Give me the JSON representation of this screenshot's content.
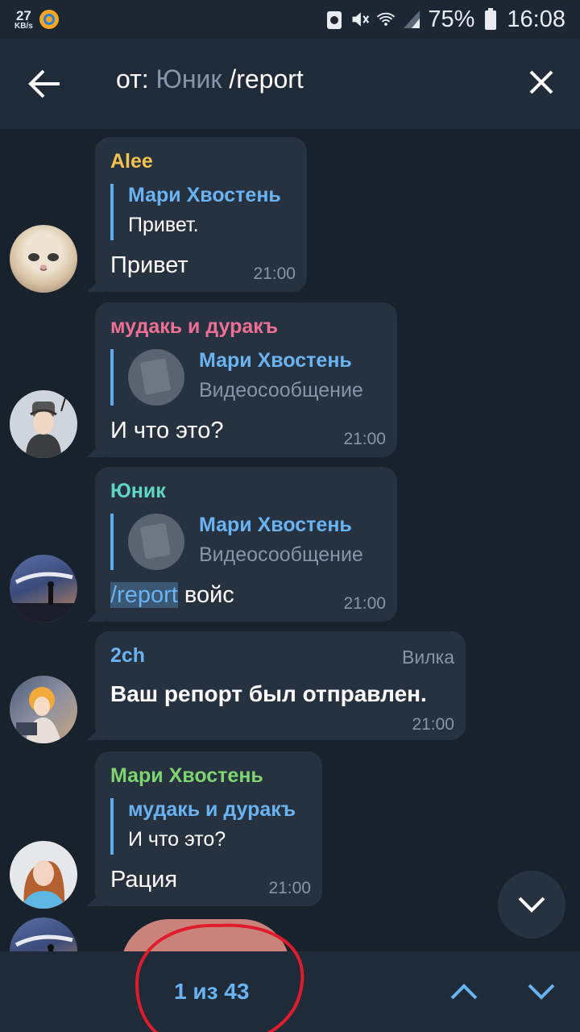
{
  "status_bar": {
    "net_speed": "27",
    "net_unit": "KB/s",
    "battery": "75%",
    "time": "16:08",
    "icons": [
      "app-icon",
      "recycle-icon",
      "mute-icon",
      "wifi-icon",
      "signal-icon",
      "battery-icon"
    ]
  },
  "header": {
    "search_prefix": "от: ",
    "search_user": "Юник",
    "search_query": " /report"
  },
  "messages": [
    {
      "sender": "Alee",
      "sender_color": "#f2c14e",
      "reply_name": "Мари Хвостень",
      "reply_text": "Привет.",
      "text": "Привет",
      "time": "21:00"
    },
    {
      "sender": "мудакь и дуракъ",
      "sender_color": "#ee6f93",
      "reply_name": "Мари Хвостень",
      "reply_text": "Видеосообщение",
      "text": "И что это?",
      "time": "21:00"
    },
    {
      "sender": "Юник",
      "sender_color": "#5fd6c4",
      "reply_name": "Мари Хвостень",
      "reply_text": "Видеосообщение",
      "text_highlight": "/report",
      "text_rest": " войс",
      "time": "21:00"
    },
    {
      "sender": "2ch",
      "sender_color": "#6ab3f3",
      "badge": "Вилка",
      "text": "Ваш репорт был отправлен.",
      "time": "21:00"
    },
    {
      "sender": "Мари Хвостень",
      "sender_color": "#7ed56f",
      "reply_name": "мудакь и дуракъ",
      "reply_text": "И что это?",
      "text": "Рация",
      "time": "21:00"
    }
  ],
  "bottom_bar": {
    "counter": "1 из 43"
  },
  "colors": {
    "background": "#18222d",
    "bubble": "#26323f",
    "accent": "#6ab3f3",
    "annotation": "#e01b2c"
  }
}
